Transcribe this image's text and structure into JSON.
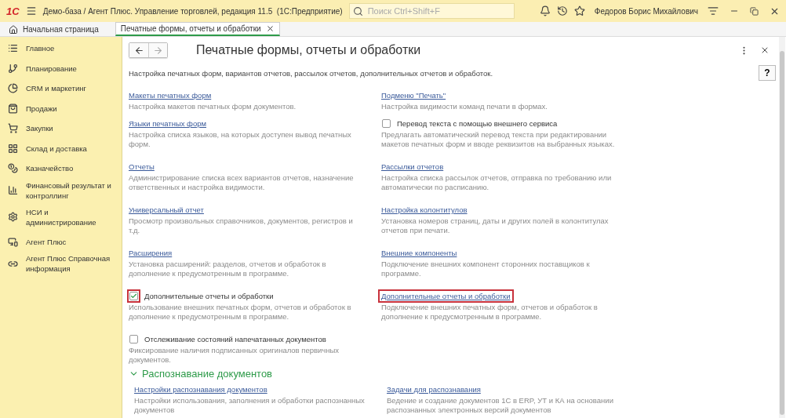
{
  "app_bar": {
    "logo": "1С",
    "title": "Демо-база / Агент Плюс. Управление торговлей, редакция 11.5  (1С:Предприятие)",
    "search": {
      "placeholder": "Поиск Ctrl+Shift+F"
    },
    "user": "Федоров Борис Михайлович"
  },
  "tabs": [
    {
      "label": "Начальная страница",
      "kind": "home",
      "selected": false
    },
    {
      "label": "Печатные формы, отчеты и обработки",
      "kind": "page",
      "selected": true
    }
  ],
  "sidebar": {
    "items": [
      {
        "label": "Главное"
      },
      {
        "label": "Планирование"
      },
      {
        "label": "CRM и маркетинг"
      },
      {
        "label": "Продажи"
      },
      {
        "label": "Закупки"
      },
      {
        "label": "Склад и доставка"
      },
      {
        "label": "Казначейство"
      },
      {
        "label": "Финансовый результат и контроллинг"
      },
      {
        "label": "НСИ и администрирование"
      },
      {
        "label": "Агент Плюс"
      },
      {
        "label": "Агент Плюс Справочная информация"
      }
    ]
  },
  "form": {
    "title": "Печатные формы, отчеты и обработки",
    "description": "Настройка печатных форм, вариантов отчетов, рассылок отчетов, дополнительных отчетов и обработок.",
    "help": "?",
    "rows": [
      {
        "left": [
          {
            "kind": "link",
            "label": "Макеты печатных форм",
            "description": "Настройка макетов печатных форм документов.",
            "highlighted": false
          },
          {
            "kind": "link",
            "label": "Языки печатных форм",
            "description": "Настройка списка языков, на которых доступен вывод печатных форм.",
            "highlighted": false
          }
        ],
        "right": [
          {
            "kind": "link",
            "label": "Подменю \"Печать\"",
            "description": "Настройка видимости команд печати в формах.",
            "highlighted": false
          },
          {
            "kind": "checkbox",
            "label": "Перевод текста с помощью внешнего сервиса",
            "checked": false,
            "description": "Предлагать автоматический перевод текста при редактировании макетов печатных форм и вводе реквизитов на выбранных языках.",
            "highlighted": false
          }
        ]
      },
      {
        "left": [
          {
            "kind": "link",
            "label": "Отчеты",
            "description": "Администрирование списка всех вариантов отчетов, назначение ответственных и настройка видимости.",
            "highlighted": false
          }
        ],
        "right": [
          {
            "kind": "link",
            "label": "Рассылки отчетов",
            "description": "Настройка списка рассылок отчетов, отправка по требованию или автоматически по расписанию.",
            "highlighted": false
          }
        ]
      },
      {
        "left": [
          {
            "kind": "link",
            "label": "Универсальный отчет",
            "description": "Просмотр произвольных справочников, документов, регистров и т.д.",
            "highlighted": false
          }
        ],
        "right": [
          {
            "kind": "link",
            "label": "Настройка колонтитулов",
            "description": "Установка номеров страниц, даты и других полей в колонтитулах отчетов при печати.",
            "highlighted": false
          }
        ]
      },
      {
        "left": [
          {
            "kind": "link",
            "label": "Расширения",
            "description": "Установка расширений: разделов, отчетов и обработок в дополнение к предусмотренным в программе.",
            "highlighted": false
          }
        ],
        "right": [
          {
            "kind": "link",
            "label": "Внешние компоненты",
            "description": "Подключение внешних компонент сторонних поставщиков к программе.",
            "highlighted": false
          }
        ]
      },
      {
        "left": [
          {
            "kind": "checkbox",
            "label": "Дополнительные отчеты и обработки",
            "checked": true,
            "description": "Использование внешних печатных форм, отчетов и обработок в дополнение к предусмотренным в программе.",
            "highlighted": true
          }
        ],
        "right": [
          {
            "kind": "link",
            "label": "Дополнительные отчеты и обработки",
            "description": "Подключение внешних печатных форм, отчетов и обработок в дополнение к предусмотренным в программе.",
            "highlighted": true
          }
        ]
      },
      {
        "left": [
          {
            "kind": "checkbox",
            "label": "Отслеживание состояний напечатанных документов",
            "checked": false,
            "description": "Фиксирование наличия подписанных оригиналов первичных документов.",
            "highlighted": false
          }
        ],
        "right": []
      }
    ],
    "groups": [
      {
        "title": "Распознавание документов",
        "expanded": true,
        "left": [
          {
            "kind": "link",
            "label": "Настройки распознавания документов",
            "description": "Настройки использования, заполнения и обработки распознанных документов",
            "highlighted": false
          }
        ],
        "right": [
          {
            "kind": "link",
            "label": "Задачи для распознавания",
            "description": "Ведение и создание документов 1С в ERP, УТ и КА на основании распознанных электронных версий документов",
            "highlighted": false
          }
        ]
      }
    ]
  }
}
